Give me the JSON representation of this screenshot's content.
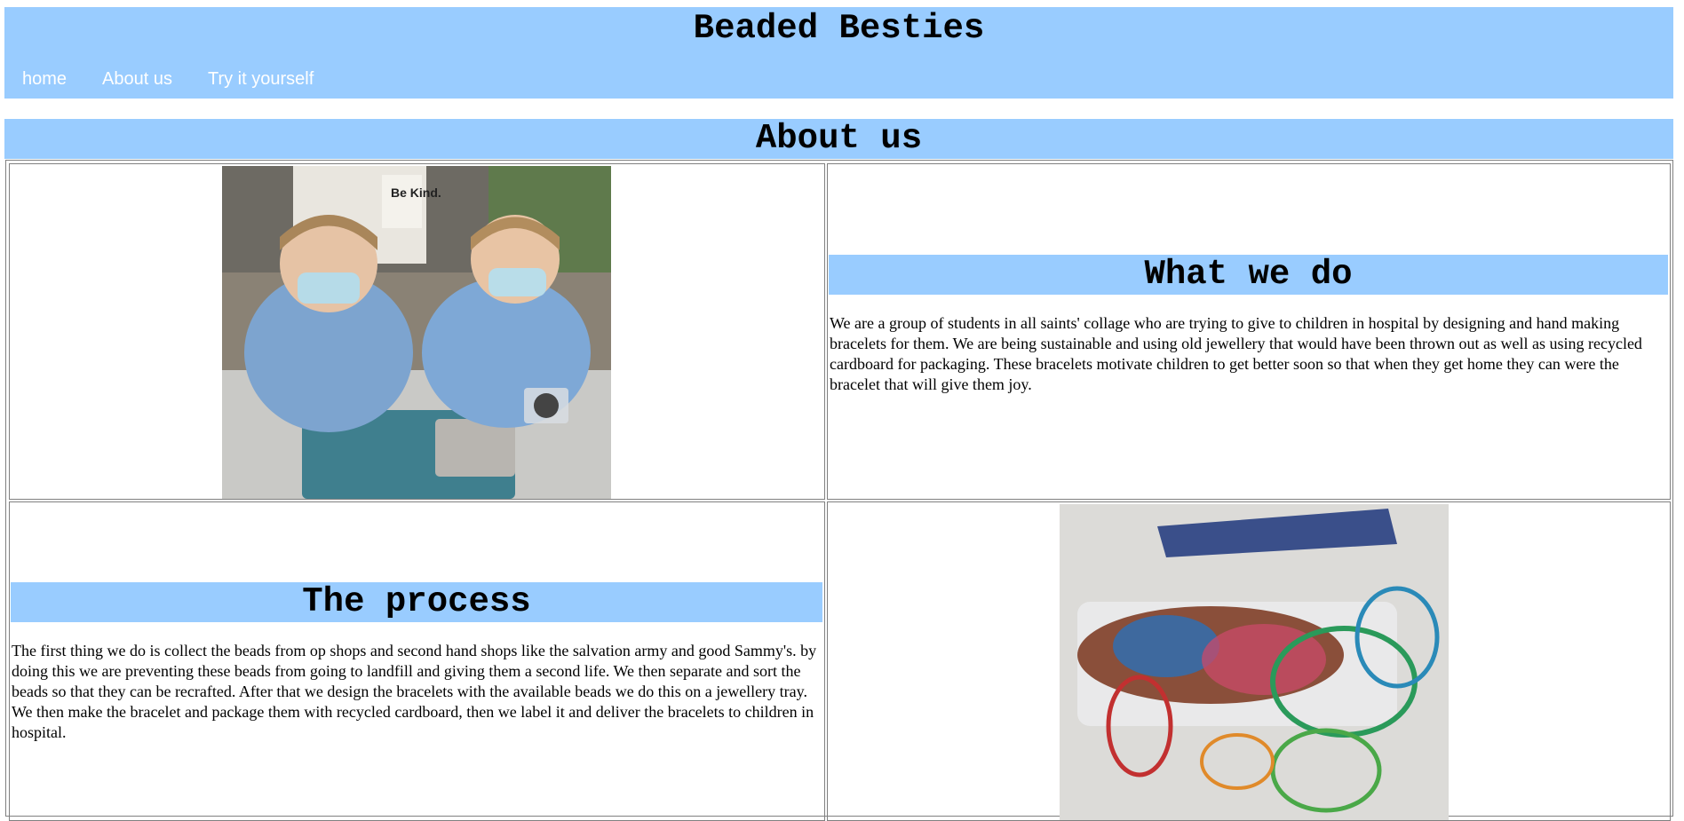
{
  "header": {
    "title": "Beaded Besties",
    "nav": [
      "home",
      "About us",
      "Try it yourself"
    ]
  },
  "page": {
    "heading": "About us"
  },
  "sections": {
    "what_we_do": {
      "heading": "What we do",
      "text": "We are a group of students in all saints' collage who are trying to give to children in hospital by designing and hand making bracelets for them. We are being sustainable and using old jewellery that would have been thrown out as well as using recycled cardboard for packaging. These bracelets motivate children to get better soon so that when they get home they can were the bracelet that will give them joy."
    },
    "the_process": {
      "heading": "The process",
      "text": "The first thing we do is collect the beads from op shops and second hand shops like the salvation army and good Sammy's. by doing this we are preventing these beads from going to landfill and giving them a second life. We then separate and sort the beads so that they can be recrafted. After that we design the bracelets with the available beads we do this on a jewellery tray. We then make the bracelet and package them with recycled cardboard, then we label it and deliver the bracelets to children in hospital."
    }
  },
  "images": {
    "photo1": {
      "text": "Be Kind."
    }
  },
  "colors": {
    "header_bg": "#99ccff",
    "nav_text": "#ffffff"
  }
}
